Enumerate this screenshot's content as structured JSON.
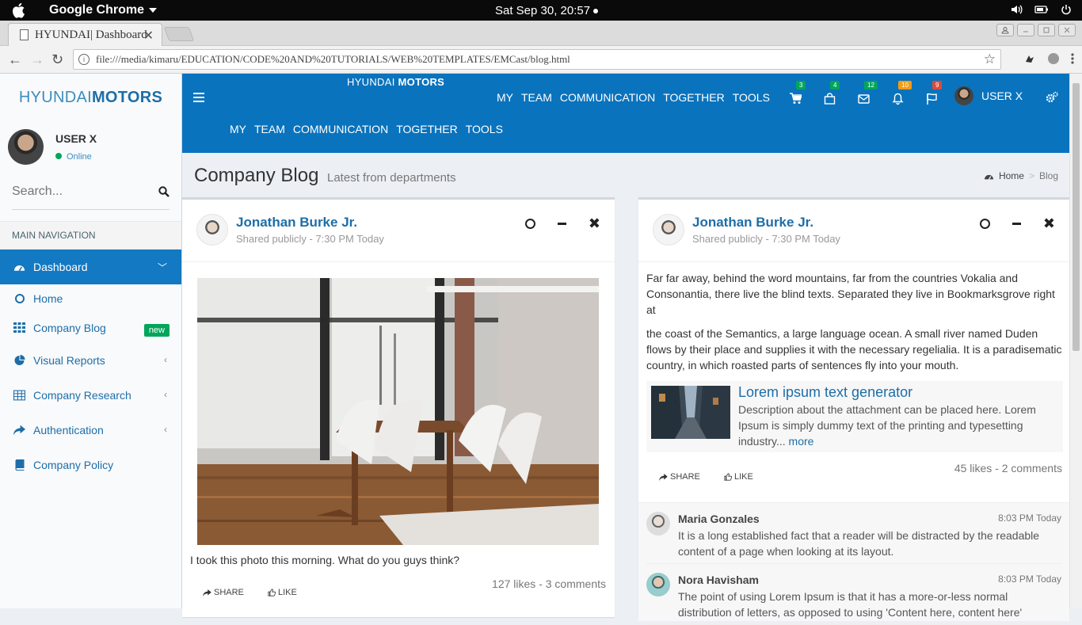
{
  "os": {
    "app_name": "Google Chrome",
    "clock": "Sat Sep 30, 20:57"
  },
  "browser": {
    "tab_title": "HYUNDAI| Dashboard",
    "url": "file:///media/kimaru/EDUCATION/CODE%20AND%20TUTORIALS/WEB%20TEMPLATES/EMCast/blog.html"
  },
  "sidebar": {
    "logo_light": "HYUNDAI",
    "logo_bold": "MOTORS",
    "user_name": "USER X",
    "user_status": "Online",
    "search_placeholder": "Search...",
    "header": "MAIN NAVIGATION",
    "items": [
      {
        "label": "Dashboard",
        "icon": "dashboard-icon",
        "active": true
      },
      {
        "label": "Home",
        "icon": "circle-icon"
      },
      {
        "label": "Company Blog",
        "icon": "grid-icon",
        "badge": "new"
      },
      {
        "label": "Visual Reports",
        "icon": "pie-chart-icon"
      },
      {
        "label": "Company Research",
        "icon": "table-icon"
      },
      {
        "label": "Authentication",
        "icon": "share-icon"
      },
      {
        "label": "Company Policy",
        "icon": "book-icon"
      }
    ]
  },
  "topnav": {
    "brand_light": "HYUNDAI ",
    "brand_bold": "MOTORS",
    "links": [
      "MY",
      "TEAM",
      "COMMUNICATION",
      "TOGETHER",
      "TOOLS"
    ],
    "badges": {
      "cart": "3",
      "bag": "4",
      "mail": "12",
      "bell": "10",
      "flag": "9"
    },
    "badge_colors": {
      "green": "#00a65a",
      "orange": "#f39c12",
      "red": "#dd4b39"
    },
    "user": "USER X"
  },
  "page": {
    "title": "Company Blog",
    "subtitle": "Latest from departments",
    "breadcrumb_home": "Home",
    "breadcrumb_sep": ">",
    "breadcrumb_current": "Blog"
  },
  "posts": [
    {
      "author": "Jonathan Burke Jr.",
      "meta": "Shared publicly - 7:30 PM Today",
      "caption": "I took this photo this morning. What do you guys think?",
      "share": "SHARE",
      "like": "LIKE",
      "stats": "127 likes - 3 comments"
    },
    {
      "author": "Jonathan Burke Jr.",
      "meta": "Shared publicly - 7:30 PM Today",
      "para1": "Far far away, behind the word mountains, far from the countries Vokalia and Consonantia, there live the blind texts. Separated they live in Bookmarksgrove right at",
      "para2": "the coast of the Semantics, a large language ocean. A small river named Duden flows by their place and supplies it with the necessary regelialia. It is a paradisematic country, in which roasted parts of sentences fly into your mouth.",
      "attachment_title": "Lorem ipsum text generator",
      "attachment_desc": "Description about the attachment can be placed here. Lorem Ipsum is simply dummy text of the printing and typesetting industry...",
      "attachment_more": "more",
      "share": "SHARE",
      "like": "LIKE",
      "stats": "45 likes - 2 comments",
      "comments": [
        {
          "name": "Maria Gonzales",
          "time": "8:03 PM Today",
          "text": "It is a long established fact that a reader will be distracted by the readable content of a page when looking at its layout."
        },
        {
          "name": "Nora Havisham",
          "time": "8:03 PM Today",
          "text": "The point of using Lorem Ipsum is that it has a more-or-less normal distribution of letters, as opposed to using 'Content here, content here'"
        }
      ]
    }
  ]
}
